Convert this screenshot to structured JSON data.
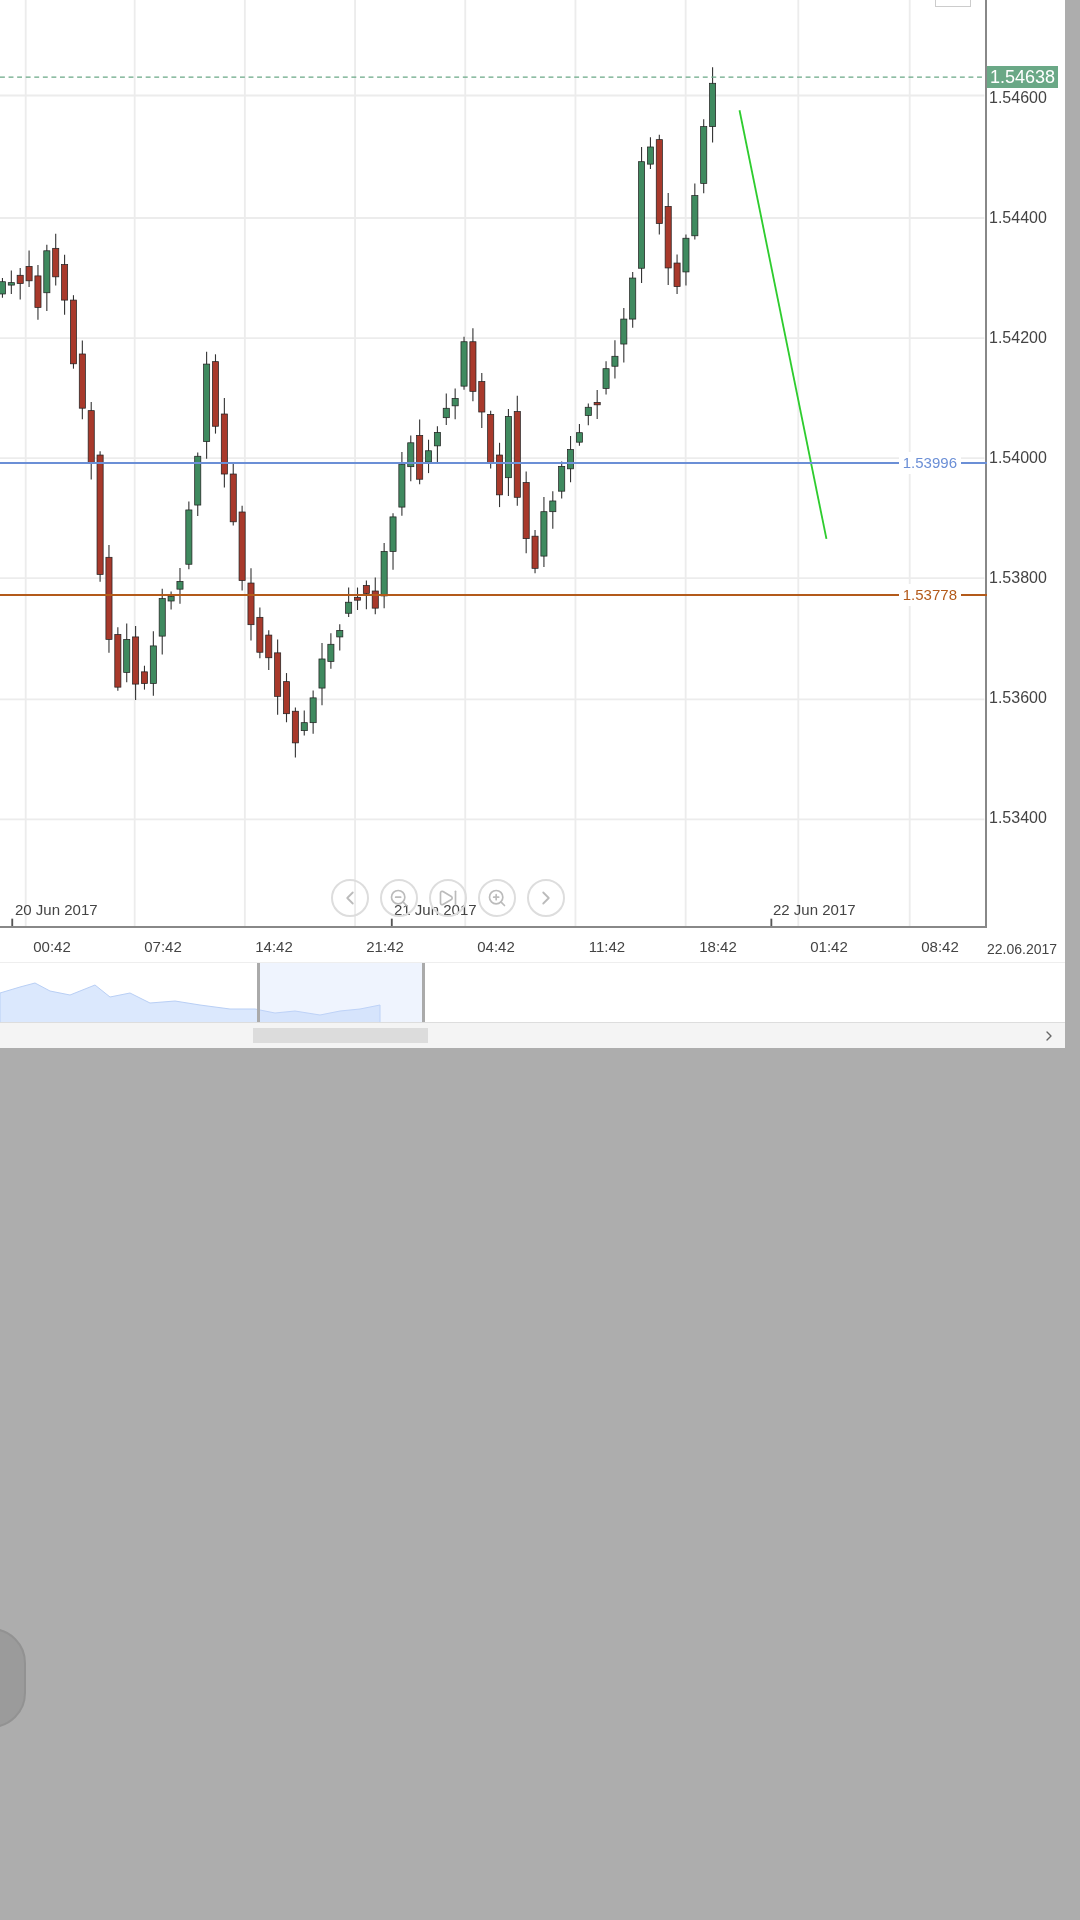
{
  "chart": {
    "current_price": "1.54638",
    "price_axis": [
      "1.54600",
      "1.54400",
      "1.54200",
      "1.54000",
      "1.53800",
      "1.53600",
      "1.53400"
    ],
    "horizontal_lines": [
      {
        "label": "1.53996",
        "color": "#6b8fd6"
      },
      {
        "label": "1.53778",
        "color": "#b35a1a"
      }
    ],
    "date_labels": [
      "20 Jun 2017",
      "21 Jun 2017",
      "22 Jun 2017"
    ],
    "time_axis": [
      "00:42",
      "07:42",
      "14:42",
      "21:42",
      "04:42",
      "11:42",
      "18:42",
      "01:42",
      "08:42"
    ],
    "end_date": "22.06.2017"
  }
}
